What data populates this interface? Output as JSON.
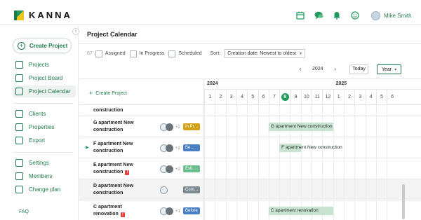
{
  "app": {
    "brand": "KANNA",
    "user_name": "Mike Smith",
    "top_icons": [
      "calendar-icon",
      "chat-icon",
      "bell-icon",
      "smiley-icon"
    ],
    "accent_color": "#1f7a4a"
  },
  "sidebar": {
    "create_label": "Create Project",
    "groups": [
      [
        {
          "label": "Projects",
          "icon": "list-icon"
        },
        {
          "label": "Project Board",
          "icon": "board-icon"
        },
        {
          "label": "Project Calendar",
          "icon": "calendar-icon",
          "active": true
        }
      ],
      [
        {
          "label": "Clients",
          "icon": "clients-icon"
        },
        {
          "label": "Properties",
          "icon": "properties-icon"
        },
        {
          "label": "Export",
          "icon": "export-icon"
        }
      ],
      [
        {
          "label": "Settings",
          "icon": "gear-icon"
        },
        {
          "label": "Members",
          "icon": "members-icon"
        },
        {
          "label": "Change plan",
          "icon": "plan-icon"
        }
      ]
    ],
    "faq": "FAQ",
    "collapse_glyph": "‹"
  },
  "main": {
    "title": "Project Calendar",
    "filters": {
      "count": "67",
      "assigned": "Assigned",
      "in_progress": "In Progress",
      "scheduled": "Scheduled",
      "sort_label": "Sort:",
      "sort_value": "Creation date: Newest to oldest"
    },
    "year_nav": {
      "prev": "‹",
      "year": "2024",
      "next": "›",
      "today": "Today",
      "view": "Year"
    },
    "create_project": "Create Project",
    "timeline": {
      "years": [
        {
          "label": "2024",
          "start_index": 0
        },
        {
          "label": "2025",
          "start_index": 12
        }
      ],
      "months": [
        "1",
        "2",
        "3",
        "4",
        "5",
        "6",
        "7",
        "8",
        "9",
        "10",
        "11",
        "12",
        "1",
        "2",
        "3",
        "4",
        "5",
        "6"
      ],
      "today_index": 7
    },
    "rows": [
      {
        "name": "construction",
        "warn": false,
        "avatars": 1,
        "extra": "",
        "status": "",
        "status_color": "#5b6bb5",
        "bar": null,
        "gray": false,
        "expand": false,
        "partial": true
      },
      {
        "name": "G apartment New construction",
        "warn": false,
        "avatars": 2,
        "extra": "+2",
        "status": "In Pr…",
        "status_color": "#d1a21a",
        "bar": {
          "label": "G apartment New construction",
          "start": 6.0,
          "end": 12.0
        },
        "gray": false,
        "expand": false
      },
      {
        "name": "F apartment New construction",
        "warn": false,
        "avatars": 2,
        "extra": "+2",
        "status": "Be…",
        "status_color": "#4a7fc4",
        "bar": {
          "label": "F apartment New construction",
          "start": 7.0,
          "end": 9.0
        },
        "gray": false,
        "expand": true
      },
      {
        "name": "E apartment New construction",
        "warn": true,
        "avatars": 2,
        "extra": "+2",
        "status": "Esti…",
        "status_color": "#6bbf8e",
        "bar": null,
        "gray": false,
        "expand": false
      },
      {
        "name": "D apartment New construction",
        "warn": false,
        "avatars": 1,
        "extra": "",
        "status": "Com…",
        "status_color": "#7d8a91",
        "bar": null,
        "gray": true,
        "expand": false
      },
      {
        "name": "C apartment renovation",
        "warn": true,
        "avatars": 2,
        "extra": "+1",
        "status": "Before",
        "status_color": "#4a7fc4",
        "bar": {
          "label": "C apartment renovation",
          "start": 6.0,
          "end": 12.0
        },
        "gray": false,
        "expand": false
      }
    ]
  }
}
